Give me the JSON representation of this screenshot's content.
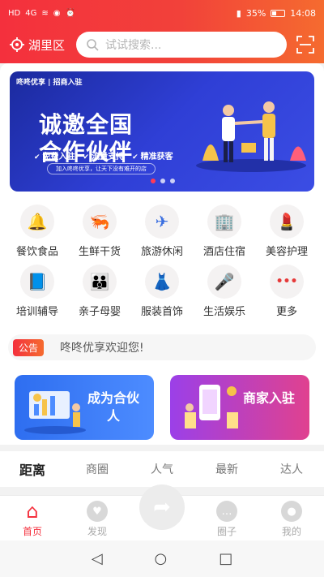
{
  "status": {
    "left_icons": [
      "HD",
      "4G",
      "wifi-icon",
      "eye-icon",
      "alarm-icon"
    ],
    "battery": "35%",
    "time": "14:08"
  },
  "header": {
    "location": "湖里区",
    "search_placeholder": "试试搜索..."
  },
  "banner": {
    "tag": "咚咚优享 | 招商入驻",
    "title_line1": "诚邀全国",
    "title_line2": "合作伙伴",
    "features": [
      "免费入驻",
      "流量支持",
      "精准获客"
    ],
    "slogan": "加入咚咚优享，让天下没有难开的店"
  },
  "categories": [
    {
      "label": "餐饮食品",
      "icon": "food-cloche-icon",
      "glyph": "🔔"
    },
    {
      "label": "生鲜干货",
      "icon": "shrimp-icon",
      "glyph": "🦐"
    },
    {
      "label": "旅游休闲",
      "icon": "airplane-icon",
      "glyph": "✈"
    },
    {
      "label": "酒店住宿",
      "icon": "hotel-icon",
      "glyph": "🏢"
    },
    {
      "label": "美容护理",
      "icon": "lipstick-icon",
      "glyph": "💄"
    },
    {
      "label": "培训辅导",
      "icon": "training-icon",
      "glyph": "📘"
    },
    {
      "label": "亲子母婴",
      "icon": "parent-child-icon",
      "glyph": "👪"
    },
    {
      "label": "服装首饰",
      "icon": "dress-icon",
      "glyph": "👗"
    },
    {
      "label": "生活娱乐",
      "icon": "microphone-icon",
      "glyph": "🎤"
    },
    {
      "label": "更多",
      "icon": "more-dots-icon",
      "glyph": "•••"
    }
  ],
  "notice": {
    "badge": "公告",
    "text": "咚咚优享欢迎您!"
  },
  "promos": {
    "partner": "成为合伙人",
    "merchant": "商家入驻"
  },
  "tabs": [
    "距离",
    "商圈",
    "人气",
    "最新",
    "达人"
  ],
  "bottom_nav": {
    "home": "首页",
    "discover": "发现",
    "circle": "圈子",
    "mine": "我的"
  }
}
